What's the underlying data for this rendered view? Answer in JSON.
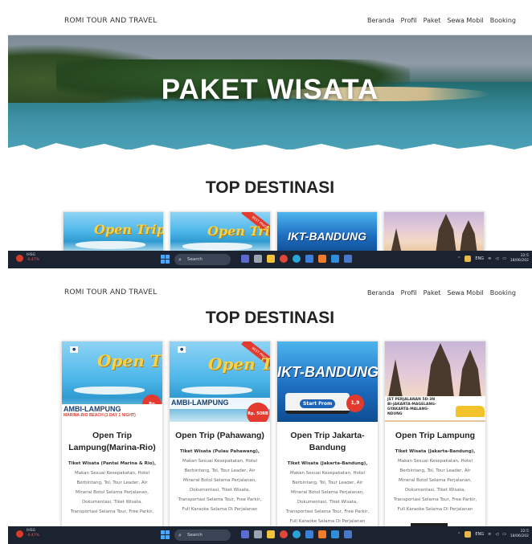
{
  "site": {
    "brand": "ROMI TOUR AND TRAVEL",
    "menu": [
      "Beranda",
      "Profil",
      "Paket",
      "Sewa Mobil",
      "Booking"
    ]
  },
  "hero": {
    "title": "PAKET WISATA"
  },
  "section": {
    "title": "TOP DESTINASI"
  },
  "cards": [
    {
      "title": "Open Trip Lampung(Marina-Rio)",
      "image_text": {
        "script": "Open Trip",
        "band": "AMBI-LAMPUNG",
        "band_sub": "MARINA-RIO BEACH (1 DAY 1 NIGHT)"
      },
      "desc_head": "Tiket Wisata (Pantai Marina & Rio),",
      "desc_lines": [
        "Makan Sesuai Kesepakatan, Hotel",
        "Berbintang, Tol, Tour Leader, Air",
        "Mineral Botol Selama Perjalanan,",
        "Dokumentasi, Tiket Wisata,",
        "Transportasi Selama Tour, Free Parkir,"
      ]
    },
    {
      "title": "Open Trip (Pahawang)",
      "image_text": {
        "script": "Open Trip",
        "band": "AMBI-LAMPUNG",
        "ribbon": "BEST PRICE",
        "price": "Rp. 50RB"
      },
      "desc_head": "Tiket Wisata (Pulau Pahawang),",
      "desc_lines": [
        "Makan Sesuai Kesepakatan, Hotel",
        "Berbintang, Tol, Tour Leader, Air",
        "Mineral Botol Selama Perjalanan,",
        "Dokumentasi, Tiket Wisata,",
        "Transportasi Selama Tour, Free Parkir,",
        "Full Karaoke Selama Di Perjalanan"
      ]
    },
    {
      "title": "Open Trip Jakarta-Bandung",
      "image_text": {
        "head": "IKT-BANDUNG",
        "from": "Start From",
        "price": "1,9"
      },
      "desc_head": "Tiket Wisata (Jakarta-Bandung),",
      "desc_lines": [
        "Makan Sesuai Kesepakatan, Hotel",
        "Berbintang, Tol, Tour Leader, Air",
        "Mineral Botol Selama Perjalanan,",
        "Dokumentasi, Tiket Wisata,",
        "Transportasi Selama Tour, Free Parkir,",
        "Full Karaoke Selama Di Perjalanan"
      ]
    },
    {
      "title": "Open Trip Lampung",
      "image_text": {
        "band": "JST PERJALANAN 5D-3N\nBI-JAKARTA-MAGELANG-\nGYAKARTA-MALANG-\nNDUNG"
      },
      "desc_head": "Tiket Wisata (Jakarta-Bandung),",
      "desc_lines": [
        "Makan Sesuai Kesepakatan, Hotel",
        "Berbintang, Tol, Tour Leader, Air",
        "Mineral Botol Selama Perjalanan,",
        "Dokumentasi, Tiket Wisata,",
        "Transportasi Selama Tour, Free Parkir,",
        "Full Karaoke Selama Di Perjalanan"
      ],
      "button": "Book Now"
    }
  ],
  "taskbar": {
    "ticker_name": "IHSG",
    "ticker_change": "-0,47%",
    "search": "Search",
    "lang": "ENG",
    "time": "22:5",
    "date": "18/06/202"
  },
  "colors": {
    "nav_bg": "#ffffff",
    "title_white": "#ffffff",
    "taskbar": "#1c2330",
    "price_red": "#e23a2c"
  }
}
